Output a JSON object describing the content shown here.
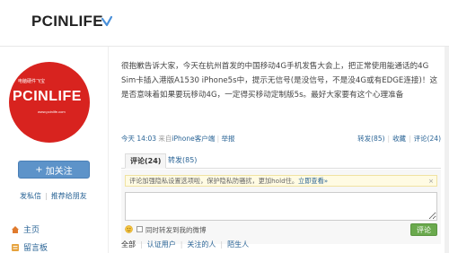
{
  "header": {
    "brand": "PCINLIFE",
    "verify_icon": "verify-check-icon"
  },
  "avatar": {
    "small_text": "电脑硬件飞宝",
    "big_text": "PCINLIFE",
    "url_text": "www.pcinlife.com",
    "bg_color": "#d8231f"
  },
  "sidebar": {
    "follow_label": "加关注",
    "links": [
      "发私信",
      "推荐给朋友"
    ],
    "nav": [
      {
        "label": "主页",
        "icon": "home-icon"
      },
      {
        "label": "留言板",
        "icon": "guestbook-icon"
      }
    ]
  },
  "post": {
    "text": "很抱歉告诉大家，今天在杭州首发的中国移动4G手机发售大会上，把正常使用能通话的4G Sim卡插入港版A1530 iPhone5s中，提示无信号(是没信号，不是没4G或有EDGE连接)！这是否意味着如果要玩移动4G，一定得买移动定制版5s。最好大家要有这个心理准备",
    "time": "今天 14:03",
    "source_prefix": "来自",
    "source": "iPhone客户端",
    "report": "举报",
    "actions": [
      "转发(85)",
      "收藏",
      "评论(24)"
    ]
  },
  "tabs": [
    {
      "label": "评论(24)",
      "active": true
    },
    {
      "label": "转发(85)",
      "active": false
    }
  ],
  "comment": {
    "notice": "评论加强隐私设置选项啦，保护隐私防骚扰，更加hold住。",
    "notice_link": "立即查看»",
    "notice_close": "×",
    "input_value": "",
    "share_checkbox_label": "同时转发到我的微博",
    "submit_label": "评论"
  },
  "filters": [
    "全部",
    "认证用户",
    "关注的人",
    "陌生人"
  ],
  "colors": {
    "link": "#2a6496",
    "follow_button": "#5d93c9",
    "submit_button": "#6aa94d"
  }
}
